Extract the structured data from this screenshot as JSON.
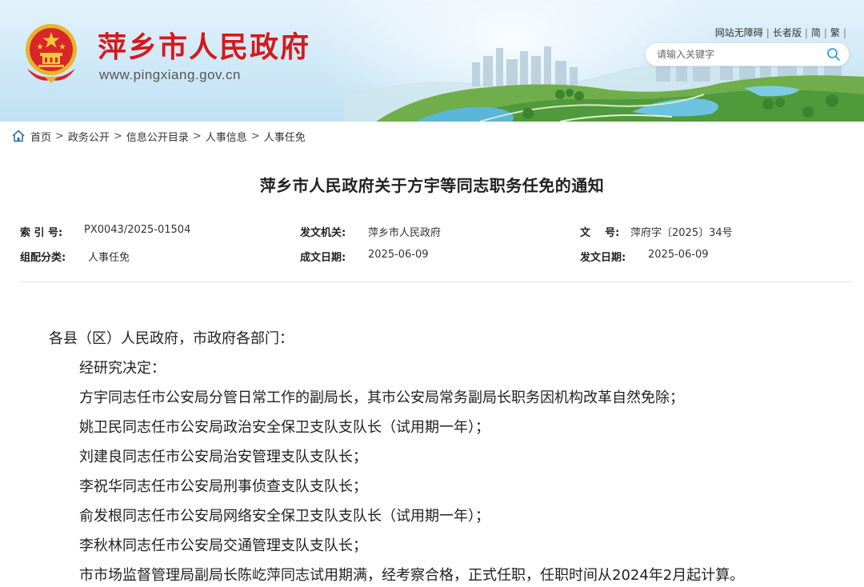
{
  "header": {
    "site_title": "萍乡市人民政府",
    "site_url": "www.pingxiang.gov.cn",
    "top_links": [
      "网站无障碍",
      "长者版",
      "简",
      "繁"
    ],
    "search_placeholder": "请输入关键字",
    "brand_color": "#d21a1e"
  },
  "breadcrumb": {
    "items": [
      "首页",
      "政务公开",
      "信息公开目录",
      "人事信息",
      "人事任免"
    ],
    "separator": ">"
  },
  "document": {
    "title": "萍乡市人民政府关于方宇等同志职务任免的通知",
    "meta": {
      "index_label": "索 引 号:",
      "index_value": "PX0043/2025-01504",
      "issuer_label": "发文机关:",
      "issuer_value": "萍乡市人民政府",
      "doc_no_label": "文    号:",
      "doc_no_value": "萍府字〔2025〕34号",
      "category_label": "组配分类:",
      "category_value": "人事任免",
      "created_label": "成文日期:",
      "created_value": "2025-06-09",
      "published_label": "发文日期:",
      "published_value": "2025-06-09"
    },
    "salutation": "各县（区）人民政府，市政府各部门：",
    "paragraphs": [
      "经研究决定：",
      "方宇同志任市公安局分管日常工作的副局长，其市公安局常务副局长职务因机构改革自然免除；",
      "姚卫民同志任市公安局政治安全保卫支队支队长（试用期一年）；",
      "刘建良同志任市公安局治安管理支队支队长；",
      "李祝华同志任市公安局刑事侦查支队支队长；",
      "俞发根同志任市公安局网络安全保卫支队支队长（试用期一年）；",
      "李秋林同志任市公安局交通管理支队支队长；",
      "市市场监督管理局副局长陈屹萍同志试用期满，经考察合格，正式任职，任职时间从2024年2月起计算。"
    ]
  }
}
